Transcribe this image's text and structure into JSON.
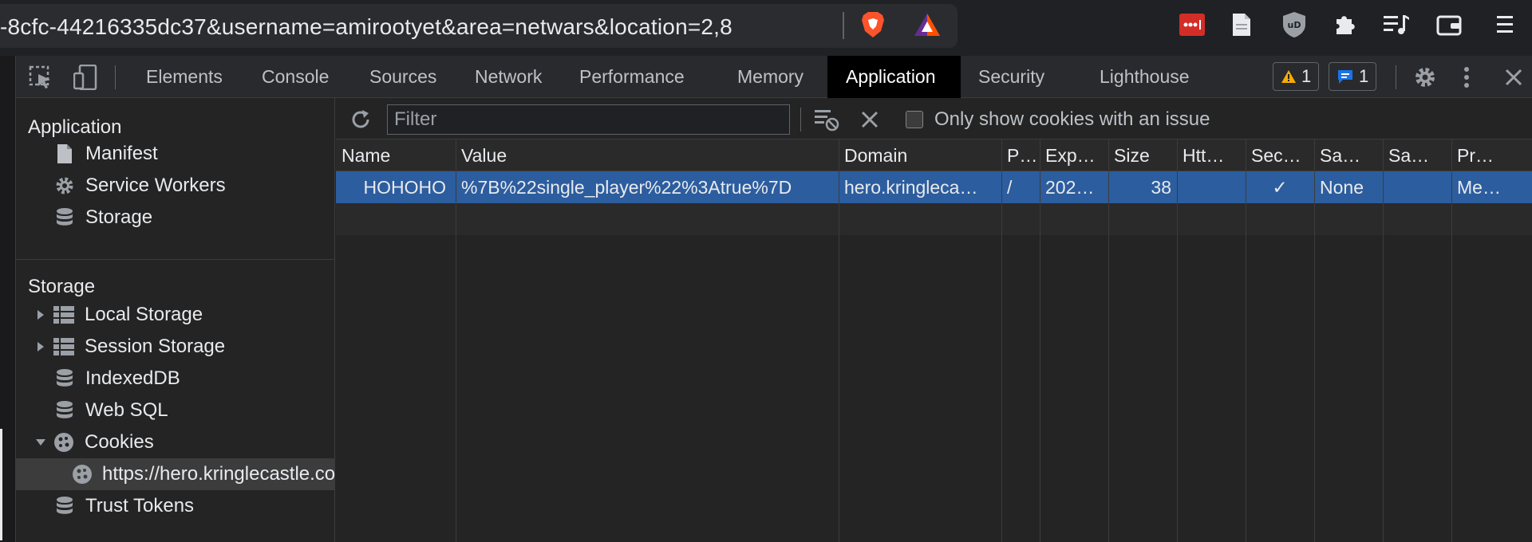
{
  "browser": {
    "url_fragment": "-8cfc-44216335dc37&username=amirootyet&area=netwars&location=2,8",
    "extension_icons": [
      "lastpass-icon",
      "document-icon",
      "ublock-icon",
      "puzzle-extension-icon",
      "media-playlist-icon",
      "wallet-icon",
      "menu-icon"
    ]
  },
  "devtools": {
    "tabs": [
      "Elements",
      "Console",
      "Sources",
      "Network",
      "Performance",
      "Memory",
      "Application",
      "Security",
      "Lighthouse"
    ],
    "active_tab": "Application",
    "warnings_count": "1",
    "messages_count": "1"
  },
  "sidebar": {
    "application_heading": "Application",
    "application_items": [
      "Manifest",
      "Service Workers",
      "Storage"
    ],
    "storage_heading": "Storage",
    "storage_items": [
      "Local Storage",
      "Session Storage",
      "IndexedDB",
      "Web SQL",
      "Cookies"
    ],
    "cookie_origin": "https://hero.kringlecastle.com",
    "trust_tokens": "Trust Tokens"
  },
  "cookies": {
    "filter_placeholder": "Filter",
    "only_issue_label": "Only show cookies with an issue",
    "only_issue_checked": false,
    "columns": [
      "Name",
      "Value",
      "Domain",
      "P…",
      "Exp…",
      "Size",
      "Htt…",
      "Sec…",
      "Sa…",
      "Sa…",
      "Pr…"
    ],
    "rows": [
      {
        "name": "HOHOHO",
        "value": "%7B%22single_player%22%3Atrue%7D",
        "domain": "hero.kringleca…",
        "path": "/",
        "expires": "202…",
        "size": "38",
        "httponly": "",
        "secure": "✓",
        "samesite": "None",
        "sameparty": "",
        "priority": "Me…"
      }
    ]
  },
  "colors": {
    "selected_row": "#2c5d9f",
    "active_tab": "#000000",
    "warning": "#f9ab00",
    "message": "#1a73e8"
  }
}
